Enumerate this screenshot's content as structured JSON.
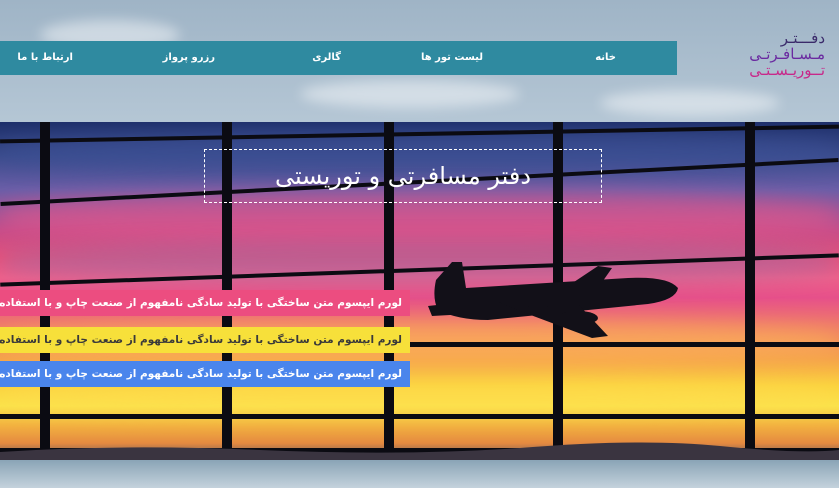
{
  "nav": {
    "items": [
      {
        "label": "خانه"
      },
      {
        "label": "لیست تور ها"
      },
      {
        "label": "گالری"
      },
      {
        "label": "رزرو پرواز"
      },
      {
        "label": "ارتباط با ما"
      }
    ]
  },
  "logo": {
    "line1": "دفـــتـر",
    "line2": "مـسـافـرتـی",
    "line3": "تــوریـسـتـی"
  },
  "hero": {
    "title": "دفتر مسافرتی و توریستی",
    "strips": [
      {
        "text": "لورم ایپسوم متن ساختگی با تولید سادگی نامفهوم از صنعت چاپ و با استفاده از طراحان گرافیک است",
        "color": "#ec4d80"
      },
      {
        "text": "لورم ایپسوم متن ساختگی با تولید سادگی نامفهوم از صنعت چاپ و با استفاده از طراحان گرافیک است",
        "color": "#f7e03a"
      },
      {
        "text": "لورم ایپسوم متن ساختگی با تولید سادگی نامفهوم از صنعت چاپ و با استفاده از طراحان گرافیک است",
        "color": "#4a85ec"
      }
    ]
  },
  "colors": {
    "nav": "#2f8aa0",
    "accent_pink": "#ec4d80",
    "accent_yellow": "#f7e03a",
    "accent_blue": "#4a85ec"
  },
  "icons": {
    "airplane": "airplane-silhouette"
  }
}
